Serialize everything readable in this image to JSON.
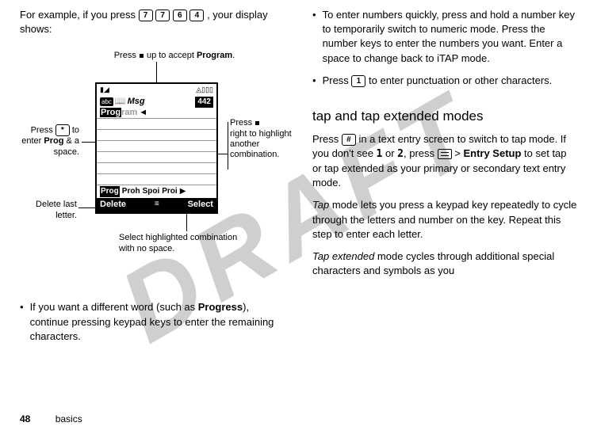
{
  "watermark": "DRAFT",
  "left": {
    "intro_prefix": "For example, if you press ",
    "intro_suffix": ", your display shows:",
    "keys": [
      "7",
      "7",
      "6",
      "4"
    ],
    "diagram": {
      "callout_top_prefix": "Press ",
      "callout_top_mid": " up to accept ",
      "callout_top_bold": "Program",
      "callout_top_suffix": ".",
      "callout_left1_prefix": "Press ",
      "callout_left1_key": "*",
      "callout_left1_mid": " to enter ",
      "callout_left1_bold": "Prog",
      "callout_left1_suffix": " & a space.",
      "callout_left2": "Delete last letter.",
      "callout_right_prefix": "Press ",
      "callout_right_suffix": " right to highlight another combination.",
      "callout_bottom": "Select highlighted combination with no space.",
      "phone": {
        "signal": "▮◢",
        "battery": "◬▯▯▯",
        "abc_icon": "abc",
        "dict_icon": "📖",
        "msg_label": "Msg",
        "count": "442",
        "prog_hilite": "Prog",
        "prog_gray": "ram",
        "suggestions": [
          "Prog",
          "Proh",
          "Spoi",
          "Proi"
        ],
        "arrow": "▶",
        "softkey_left": "Delete",
        "softkey_mid": "≡",
        "softkey_right": "Select"
      }
    },
    "bullet_prefix": "If you want a different word (such as ",
    "bullet_bold": "Progress",
    "bullet_suffix": "), continue pressing keypad keys to enter the remaining characters."
  },
  "right": {
    "bullet1": "To enter numbers quickly, press and hold a number key to temporarily switch to numeric mode. Press the number keys to enter the numbers you want. Enter a space to change back to iTAP mode.",
    "bullet2_prefix": "Press ",
    "bullet2_key": "1",
    "bullet2_suffix": " to enter punctuation or other characters.",
    "heading": "tap and tap extended modes",
    "p1_prefix": "Press ",
    "p1_key": "#",
    "p1_mid1": " in a text entry screen to switch to tap mode. If you don't see ",
    "p1_mode1": "1",
    "p1_mid2": " or ",
    "p1_mode2": "2",
    "p1_mid3": ", press ",
    "p1_sep": " > ",
    "p1_bold": "Entry Setup",
    "p1_suffix": " to set tap or tap extended as your primary or secondary text entry mode.",
    "p2_italic": "Tap",
    "p2_suffix": " mode lets you press a keypad key repeatedly to cycle through the letters and number on the key. Repeat this step to enter each letter.",
    "p3_italic": "Tap extended",
    "p3_suffix": " mode cycles through additional special characters and symbols as you"
  },
  "footer": {
    "pagenum": "48",
    "section": "basics"
  }
}
